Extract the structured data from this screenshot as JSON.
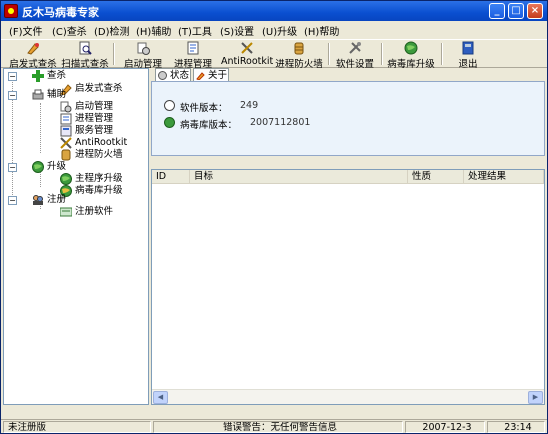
{
  "window": {
    "title": "反木马病毒专家"
  },
  "title_buttons": {
    "minimize": "_",
    "maximize": "□",
    "close": "×"
  },
  "menu": [
    {
      "label": "(F)文件"
    },
    {
      "label": "(C)查杀"
    },
    {
      "label": "(D)检测"
    },
    {
      "label": "(H)辅助"
    },
    {
      "label": "(T)工具"
    },
    {
      "label": "(S)设置"
    },
    {
      "label": "(U)升级"
    },
    {
      "label": "(H)帮助"
    }
  ],
  "toolbar": [
    {
      "label": "启发式查杀",
      "icon": "pen-scan-icon"
    },
    {
      "label": "扫描式查杀",
      "icon": "scan-doc-icon"
    },
    {
      "label": "启动管理",
      "icon": "startup-icon"
    },
    {
      "label": "进程管理",
      "icon": "process-icon"
    },
    {
      "label": "AntiRootkit",
      "icon": "tools-icon"
    },
    {
      "label": "进程防火墙",
      "icon": "firewall-icon"
    },
    {
      "label": "软件设置",
      "icon": "settings-icon"
    },
    {
      "label": "病毒库升级",
      "icon": "globe-icon"
    },
    {
      "label": "退出",
      "icon": "exit-icon"
    }
  ],
  "tree": {
    "kill": {
      "label": "查杀",
      "children": [
        "启发式查杀"
      ]
    },
    "aux": {
      "label": "辅助",
      "children": [
        "启动管理",
        "进程管理",
        "服务管理",
        "AntiRootkit",
        "进程防火墙"
      ]
    },
    "upgrade": {
      "label": "升级",
      "children": [
        "主程序升级",
        "病毒库升级"
      ]
    },
    "register": {
      "label": "注册",
      "children": [
        "注册软件"
      ]
    }
  },
  "tabs": [
    {
      "label": "状态"
    },
    {
      "label": "关于"
    }
  ],
  "info": {
    "software_version_label": "软件版本：",
    "software_version": "249",
    "virus_db_label": "病毒库版本：",
    "virus_db_version": "2007112801"
  },
  "list": {
    "columns": [
      "ID",
      "目标",
      "性质",
      "处理结果"
    ]
  },
  "status": {
    "registration": "未注册版",
    "warning": "错误警告：无任何警告信息",
    "date": "2007-12-3",
    "time": "23:14"
  },
  "colors": {
    "titlebar": "#0a4fd0",
    "panel_bg": "#ece9d8",
    "info_bg": "#ebf3fb"
  }
}
